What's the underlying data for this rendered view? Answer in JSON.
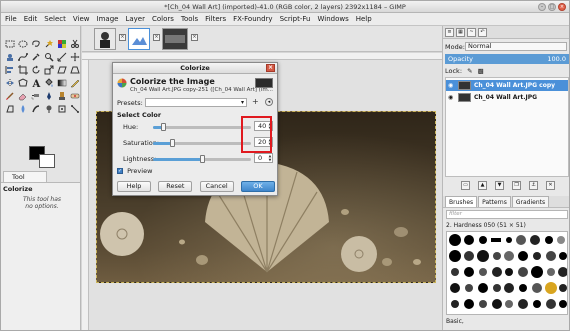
{
  "window": {
    "title": "*[Ch_04 Wall Art] (imported)-41.0 (RGB color, 2 layers) 2392x1184 – GIMP",
    "controls": [
      "–",
      "□",
      "×"
    ]
  },
  "menubar": [
    "File",
    "Edit",
    "Select",
    "View",
    "Image",
    "Layer",
    "Colors",
    "Tools",
    "Filters",
    "FX-Foundry",
    "Script-Fu",
    "Windows",
    "Help"
  ],
  "toolbox": {
    "tool_options_tab": "Tool Options",
    "tool_options_title": "Colorize",
    "tool_options_note": "This tool has no options."
  },
  "dialog": {
    "title": "Colorize",
    "close": "×",
    "heading": "Colorize the Image",
    "subtitle": "Ch_04 Wall Art.JPG copy-251 ([Ch_04 Wall Art] (im...",
    "presets_label": "Presets:",
    "presets_add": "+",
    "section_title": "Select Color",
    "sliders": [
      {
        "label": "Hue:",
        "value": "40",
        "fraction": 0.11
      },
      {
        "label": "Saturation:",
        "value": "20",
        "fraction": 0.2
      },
      {
        "label": "Lightness:",
        "value": "0",
        "fraction": 0.5
      }
    ],
    "preview_label": "Preview",
    "buttons": {
      "help": "Help",
      "reset": "Reset",
      "cancel": "Cancel",
      "ok": "OK"
    }
  },
  "dock": {
    "mode_label": "Mode:",
    "mode_value": "Normal",
    "opacity_label": "Opacity",
    "opacity_value": "100.0",
    "lock_label": "Lock:",
    "layers": [
      {
        "name": "Ch_04 Wall Art.JPG copy",
        "selected": true
      },
      {
        "name": "Ch_04 Wall Art.JPG",
        "selected": false
      }
    ],
    "brush_tabs": [
      "Brushes",
      "Patterns",
      "Gradients"
    ],
    "filter_placeholder": "filter",
    "brush_caption": "2. Hardness 050 (51 × 51)",
    "brush_footer": "Basic,"
  },
  "colors": {
    "accent": "#4a90d9",
    "highlight": "#e0191f"
  }
}
